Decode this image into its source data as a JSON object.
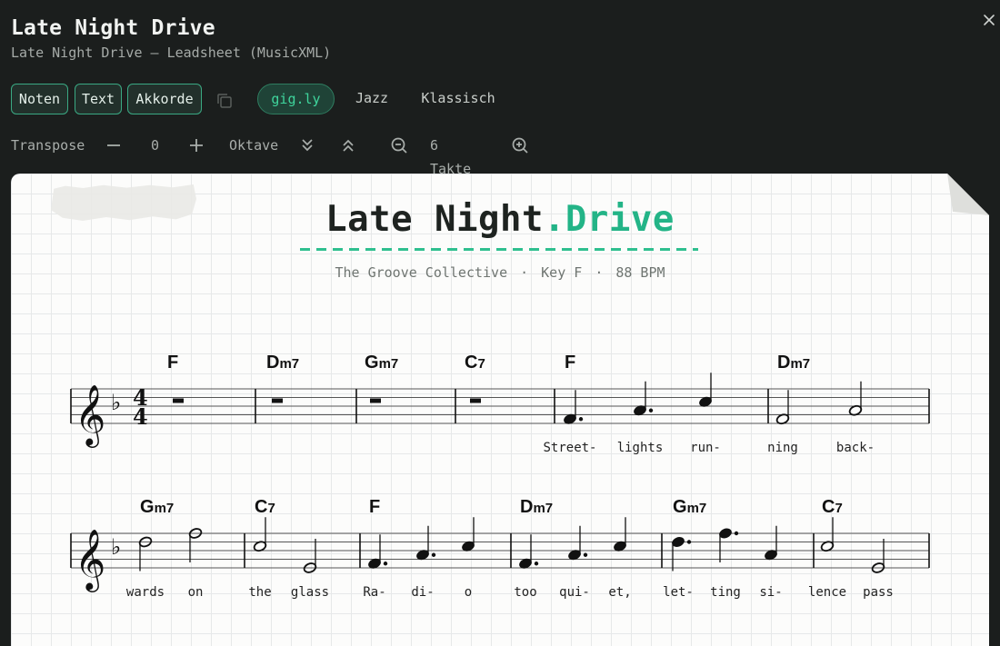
{
  "header": {
    "title": "Late Night Drive",
    "subtitle": "Late Night Drive — Leadsheet (MusicXML)"
  },
  "toolbar": {
    "view_modes": [
      "Noten",
      "Text",
      "Akkorde"
    ],
    "styles": [
      "gig.ly",
      "Jazz",
      "Klassisch"
    ],
    "active_style": "gig.ly"
  },
  "controls": {
    "transpose_label": "Transpose",
    "transpose_value": "0",
    "octave_label": "Oktave",
    "measures_label": "6 Takte"
  },
  "sheet": {
    "title_main": "Late Night",
    "title_accent": ".Drive",
    "artist": "The Groove Collective",
    "key_label": "Key F",
    "tempo_label": "88 BPM",
    "time_signature": "4/4",
    "key_signature": "F major (one flat)",
    "systems": [
      {
        "measures": [
          {
            "chords": [
              {
                "root": "F",
                "quality": ""
              }
            ],
            "notes": [
              {
                "type": "rest",
                "duration": "whole"
              }
            ]
          },
          {
            "chords": [
              {
                "root": "D",
                "quality": "m7"
              }
            ],
            "notes": [
              {
                "type": "rest",
                "duration": "whole"
              }
            ]
          },
          {
            "chords": [
              {
                "root": "G",
                "quality": "m7"
              }
            ],
            "notes": [
              {
                "type": "rest",
                "duration": "whole"
              }
            ]
          },
          {
            "chords": [
              {
                "root": "C",
                "quality": "7"
              }
            ],
            "notes": [
              {
                "type": "rest",
                "duration": "whole"
              }
            ]
          },
          {
            "chords": [
              {
                "root": "F",
                "quality": ""
              }
            ],
            "notes": [
              {
                "pitch": "F4",
                "duration": "dotted-quarter",
                "lyric": "Street-"
              },
              {
                "pitch": "A4",
                "duration": "dotted-quarter",
                "lyric": "lights"
              },
              {
                "pitch": "C5",
                "duration": "quarter",
                "lyric": "run-"
              }
            ]
          },
          {
            "chords": [
              {
                "root": "D",
                "quality": "m7"
              }
            ],
            "notes": [
              {
                "pitch": "F4",
                "duration": "half",
                "lyric": "ning"
              },
              {
                "pitch": "A4",
                "duration": "half",
                "lyric": "back-"
              }
            ]
          }
        ]
      },
      {
        "measures": [
          {
            "chords": [
              {
                "root": "G",
                "quality": "m7"
              }
            ],
            "notes": [
              {
                "pitch": "D5",
                "duration": "half",
                "lyric": "wards"
              },
              {
                "pitch": "F5",
                "duration": "half",
                "lyric": "on"
              }
            ]
          },
          {
            "chords": [
              {
                "root": "C",
                "quality": "7"
              }
            ],
            "notes": [
              {
                "pitch": "C5",
                "duration": "half",
                "lyric": "the"
              },
              {
                "pitch": "E4",
                "duration": "half",
                "lyric": "glass"
              }
            ]
          },
          {
            "chords": [
              {
                "root": "F",
                "quality": ""
              }
            ],
            "notes": [
              {
                "pitch": "F4",
                "duration": "dotted-quarter",
                "lyric": "Ra-"
              },
              {
                "pitch": "A4",
                "duration": "dotted-quarter",
                "lyric": "di-"
              },
              {
                "pitch": "C5",
                "duration": "quarter",
                "lyric": "o"
              }
            ]
          },
          {
            "chords": [
              {
                "root": "D",
                "quality": "m7"
              }
            ],
            "notes": [
              {
                "pitch": "F4",
                "duration": "dotted-quarter",
                "lyric": "too"
              },
              {
                "pitch": "A4",
                "duration": "dotted-quarter",
                "lyric": "qui-"
              },
              {
                "pitch": "C5",
                "duration": "quarter",
                "lyric": "et,"
              }
            ]
          },
          {
            "chords": [
              {
                "root": "G",
                "quality": "m7"
              }
            ],
            "notes": [
              {
                "pitch": "D5",
                "duration": "dotted-quarter",
                "lyric": "let-"
              },
              {
                "pitch": "F5",
                "duration": "dotted-quarter",
                "lyric": "ting"
              },
              {
                "pitch": "A4",
                "duration": "quarter",
                "lyric": "si-"
              }
            ]
          },
          {
            "chords": [
              {
                "root": "C",
                "quality": "7"
              }
            ],
            "notes": [
              {
                "pitch": "C5",
                "duration": "half",
                "lyric": "lence"
              },
              {
                "pitch": "E4",
                "duration": "half",
                "lyric": "pass"
              }
            ]
          }
        ]
      }
    ]
  },
  "colors": {
    "accent": "#23b487",
    "background": "#1b1e1d",
    "pill_border": "#3aa983"
  }
}
